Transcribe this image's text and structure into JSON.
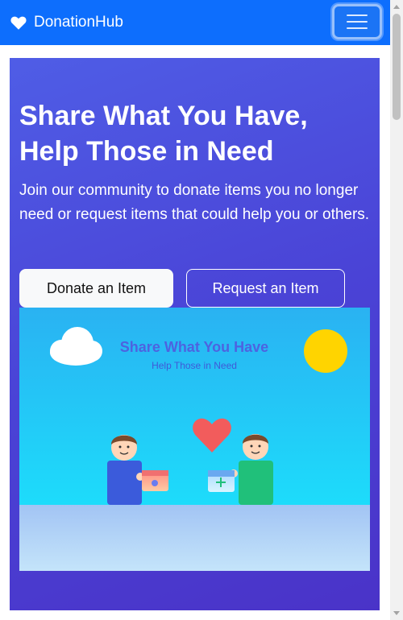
{
  "nav": {
    "brand": "DonationHub",
    "brand_icon": "heart-icon",
    "menu_icon": "hamburger-menu-icon"
  },
  "hero": {
    "title": "Share What You Have, Help Those in Need",
    "subtitle": "Join our community to donate items you no longer need or request items that could help you or others.",
    "donate_button": "Donate an Item",
    "request_button": "Request an Item"
  },
  "illustration": {
    "headline": "Share What You Have",
    "tagline": "Help Those in Need"
  },
  "colors": {
    "navbar": "#0d6efd",
    "hero_gradient_start": "#4f5de6",
    "hero_gradient_end": "#4a33c8",
    "sky": "#1fc6f7",
    "sun": "#ffd400",
    "heart": "#f25c5c",
    "person_left_shirt": "#3b5bdb",
    "person_right_shirt": "#20c07a"
  }
}
